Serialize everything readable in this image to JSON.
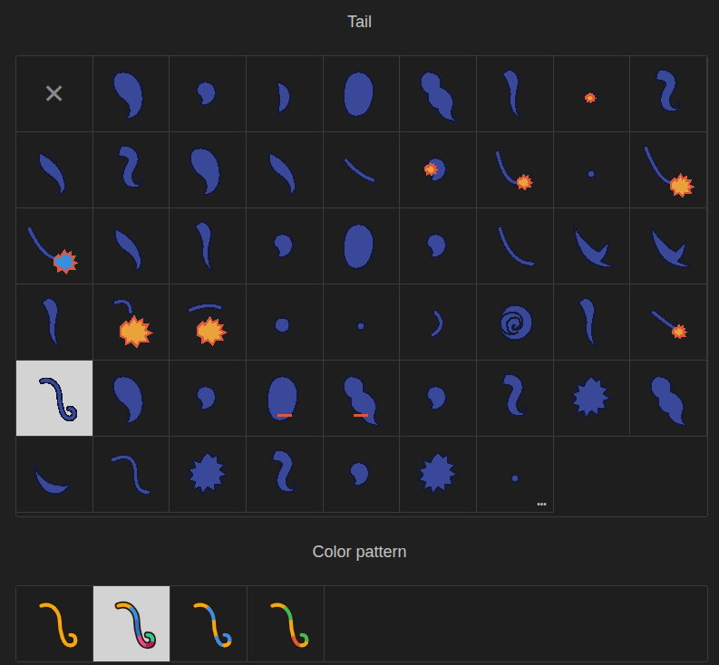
{
  "tail_section": {
    "title": "Tail",
    "items": [
      {
        "kind": "none",
        "label": "✕",
        "selected": false
      },
      {
        "kind": "tail",
        "selected": false
      },
      {
        "kind": "tail",
        "selected": false
      },
      {
        "kind": "tail",
        "selected": false
      },
      {
        "kind": "tail",
        "selected": false
      },
      {
        "kind": "tail",
        "selected": false
      },
      {
        "kind": "tail",
        "selected": false
      },
      {
        "kind": "tail",
        "selected": false
      },
      {
        "kind": "tail",
        "selected": false
      },
      {
        "kind": "tail",
        "selected": false
      },
      {
        "kind": "tail",
        "selected": false
      },
      {
        "kind": "tail",
        "selected": false
      },
      {
        "kind": "tail",
        "selected": false
      },
      {
        "kind": "tail",
        "selected": false
      },
      {
        "kind": "tail",
        "selected": false
      },
      {
        "kind": "tail",
        "selected": false
      },
      {
        "kind": "tail",
        "selected": false
      },
      {
        "kind": "tail",
        "selected": false
      },
      {
        "kind": "tail",
        "selected": false
      },
      {
        "kind": "tail",
        "selected": false
      },
      {
        "kind": "tail",
        "selected": false
      },
      {
        "kind": "tail",
        "selected": false
      },
      {
        "kind": "tail",
        "selected": false
      },
      {
        "kind": "tail",
        "selected": false
      },
      {
        "kind": "tail",
        "selected": false
      },
      {
        "kind": "tail",
        "selected": false
      },
      {
        "kind": "tail",
        "selected": false
      },
      {
        "kind": "tail",
        "selected": false
      },
      {
        "kind": "tail",
        "selected": false
      },
      {
        "kind": "tail",
        "selected": false
      },
      {
        "kind": "tail",
        "selected": false
      },
      {
        "kind": "tail",
        "selected": false
      },
      {
        "kind": "tail",
        "selected": false
      },
      {
        "kind": "tail",
        "selected": false
      },
      {
        "kind": "tail",
        "selected": false
      },
      {
        "kind": "tail",
        "selected": false
      },
      {
        "kind": "tail",
        "selected": true
      },
      {
        "kind": "tail",
        "selected": false
      },
      {
        "kind": "tail",
        "selected": false
      },
      {
        "kind": "tail",
        "selected": false
      },
      {
        "kind": "tail",
        "selected": false
      },
      {
        "kind": "tail",
        "selected": false
      },
      {
        "kind": "tail",
        "selected": false
      },
      {
        "kind": "tail",
        "selected": false
      },
      {
        "kind": "tail",
        "selected": false
      },
      {
        "kind": "tail",
        "selected": false
      },
      {
        "kind": "tail",
        "selected": false
      },
      {
        "kind": "tail",
        "selected": false
      },
      {
        "kind": "tail",
        "selected": false
      },
      {
        "kind": "tail",
        "selected": false
      },
      {
        "kind": "tail",
        "selected": false
      },
      {
        "kind": "tail",
        "selected": false,
        "more": "•••"
      }
    ]
  },
  "color_pattern_section": {
    "title": "Color pattern",
    "items": [
      {
        "selected": false,
        "colors": [
          "#f0a818",
          "#f0a818",
          "#f0a818",
          "#f0a818",
          "#f0a818",
          "#f0a818"
        ]
      },
      {
        "selected": true,
        "colors": [
          "#f0a818",
          "#3b8ee8",
          "#2f6fd0",
          "#e84a8a",
          "#b02060",
          "#30c8a0"
        ]
      },
      {
        "selected": false,
        "colors": [
          "#f0a818",
          "#3b8ee8",
          "#f0a818",
          "#3b8ee8",
          "#f0a818",
          "#3b8ee8"
        ]
      },
      {
        "selected": false,
        "colors": [
          "#f0a818",
          "#40b860",
          "#f0a818",
          "#e05a3a",
          "#f0a818",
          "#40b860"
        ]
      }
    ]
  }
}
